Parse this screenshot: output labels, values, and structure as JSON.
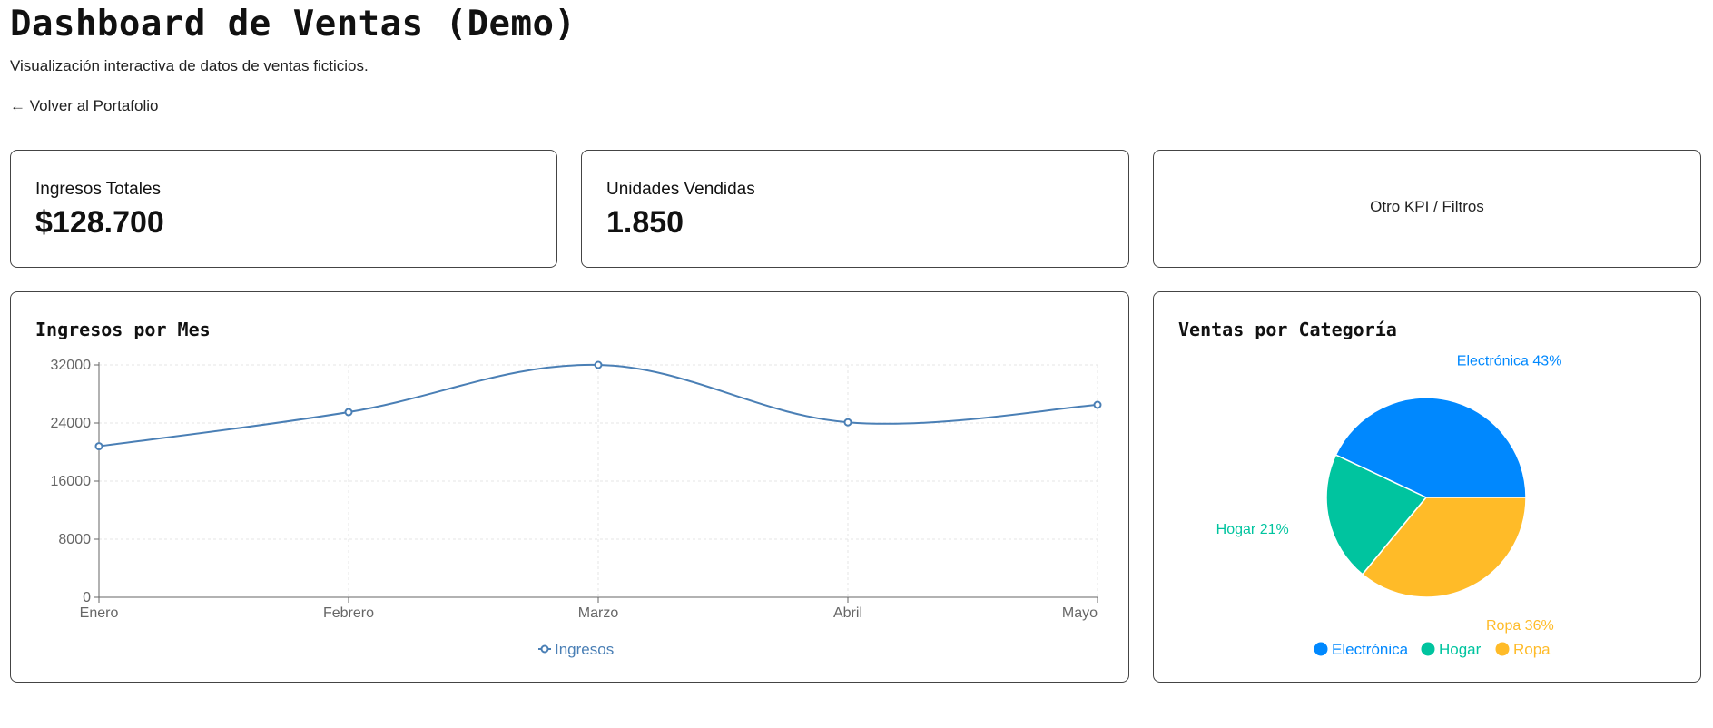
{
  "page": {
    "title": "Dashboard de Ventas (Demo)",
    "subtitle": "Visualización interactiva de datos de ventas ficticios.",
    "back_link": "← Volver al Portafolio"
  },
  "kpis": [
    {
      "label": "Ingresos Totales",
      "value": "$128.700"
    },
    {
      "label": "Unidades Vendidas",
      "value": "1.850"
    }
  ],
  "kpi_placeholder": "Otro KPI / Filtros",
  "colors": {
    "line": "#4a7fb5",
    "electronica": "#0088fe",
    "hogar": "#00c49f",
    "ropa": "#ffbb28",
    "grid": "#e6e6e6",
    "axis": "#666666"
  },
  "chart_data": [
    {
      "type": "line",
      "title": "Ingresos por Mes",
      "categories": [
        "Enero",
        "Febrero",
        "Marzo",
        "Abril",
        "Mayo"
      ],
      "series": [
        {
          "name": "Ingresos",
          "values": [
            20800,
            25500,
            32000,
            24100,
            26500
          ]
        }
      ],
      "ylim": [
        0,
        32000
      ],
      "yticks": [
        0,
        8000,
        16000,
        24000,
        32000
      ],
      "grid": true,
      "legend": "bottom"
    },
    {
      "type": "pie",
      "title": "Ventas por Categoría",
      "labels": [
        "Electrónica",
        "Hogar",
        "Ropa"
      ],
      "values": [
        43,
        21,
        36
      ],
      "slice_labels": [
        "Electrónica 43%",
        "Hogar 21%",
        "Ropa 36%"
      ],
      "legend": "bottom"
    }
  ]
}
